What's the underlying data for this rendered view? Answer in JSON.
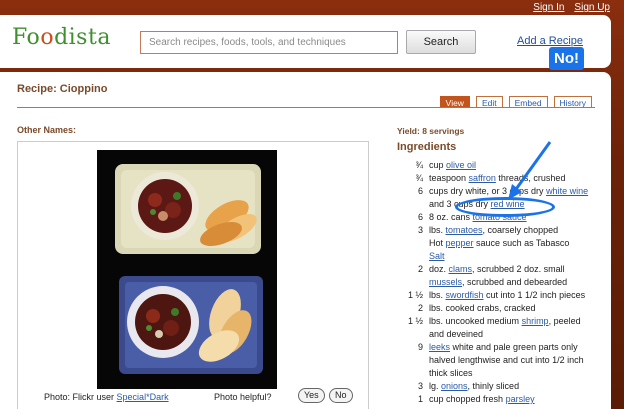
{
  "top_links": [
    "Sign In",
    "Sign Up"
  ],
  "logo": {
    "pre": "Fo",
    "o": "o",
    "post": "dista"
  },
  "search": {
    "placeholder": "Search recipes, foods, tools, and techniques",
    "button": "Search"
  },
  "add_recipe": "Add a Recipe",
  "recipe_title": "Recipe: Cioppino",
  "tabs": [
    "View",
    "Edit",
    "Embed",
    "History"
  ],
  "other_names_label": "Other Names:",
  "photo": {
    "credit_prefix": "Photo: Flickr user",
    "credit_user": "Special*Dark",
    "helpful_label": "Photo helpful?",
    "yes": "Yes",
    "no": "No"
  },
  "yield": "Yield: 8 servings",
  "ingredients_heading": "Ingredients",
  "annotation": "No!",
  "ingredients": [
    {
      "qty": "¾",
      "parts": [
        {
          "t": "cup "
        },
        {
          "t": "olive oil",
          "link": true
        }
      ]
    },
    {
      "qty": "¾",
      "parts": [
        {
          "t": "teaspoon "
        },
        {
          "t": "saffron",
          "link": true
        },
        {
          "t": " threads, crushed"
        }
      ]
    },
    {
      "qty": "6",
      "parts": [
        {
          "t": "cups dry white, or 3 cups dry "
        },
        {
          "t": "white wine",
          "link": true
        }
      ]
    },
    {
      "qty": "",
      "parts": [
        {
          "t": "and 3 cups dry "
        },
        {
          "t": "red wine",
          "link": true
        }
      ]
    },
    {
      "qty": "6",
      "parts": [
        {
          "t": "8 oz. cans "
        },
        {
          "t": "tomato sauce",
          "link": true
        }
      ]
    },
    {
      "qty": "3",
      "parts": [
        {
          "t": "lbs. "
        },
        {
          "t": "tomatoes",
          "link": true
        },
        {
          "t": ", coarsely chopped"
        }
      ]
    },
    {
      "qty": "",
      "parts": [
        {
          "t": "Hot "
        },
        {
          "t": "pepper",
          "link": true
        },
        {
          "t": " sauce such as Tabasco"
        }
      ]
    },
    {
      "qty": "",
      "parts": [
        {
          "t": "Salt",
          "link": true
        }
      ]
    },
    {
      "qty": "2",
      "parts": [
        {
          "t": "doz. "
        },
        {
          "t": "clams",
          "link": true
        },
        {
          "t": ", scrubbed 2 doz. small"
        }
      ]
    },
    {
      "qty": "",
      "parts": [
        {
          "t": "mussels",
          "link": true
        },
        {
          "t": ", scrubbed and debearded"
        }
      ]
    },
    {
      "qty": "1 ½",
      "parts": [
        {
          "t": "lbs. "
        },
        {
          "t": "swordfish",
          "link": true
        },
        {
          "t": " cut into 1 1/2 inch pieces"
        }
      ]
    },
    {
      "qty": "2",
      "parts": [
        {
          "t": "lbs. cooked crabs, cracked"
        }
      ]
    },
    {
      "qty": "1 ½",
      "parts": [
        {
          "t": "lbs. uncooked medium "
        },
        {
          "t": "shrimp",
          "link": true
        },
        {
          "t": ", peeled"
        }
      ]
    },
    {
      "qty": "",
      "parts": [
        {
          "t": "and deveined"
        }
      ]
    },
    {
      "qty": "9",
      "parts": [
        {
          "t": "leeks",
          "link": true
        },
        {
          "t": " white and pale green parts only"
        }
      ]
    },
    {
      "qty": "",
      "parts": [
        {
          "t": "halved lengthwise and cut into 1/2 inch"
        }
      ]
    },
    {
      "qty": "",
      "parts": [
        {
          "t": "thick slices"
        }
      ]
    },
    {
      "qty": "3",
      "parts": [
        {
          "t": "lg. "
        },
        {
          "t": "onions",
          "link": true
        },
        {
          "t": ", thinly sliced"
        }
      ]
    },
    {
      "qty": "1",
      "parts": [
        {
          "t": "cup chopped fresh "
        },
        {
          "t": "parsley",
          "link": true
        }
      ]
    }
  ]
}
